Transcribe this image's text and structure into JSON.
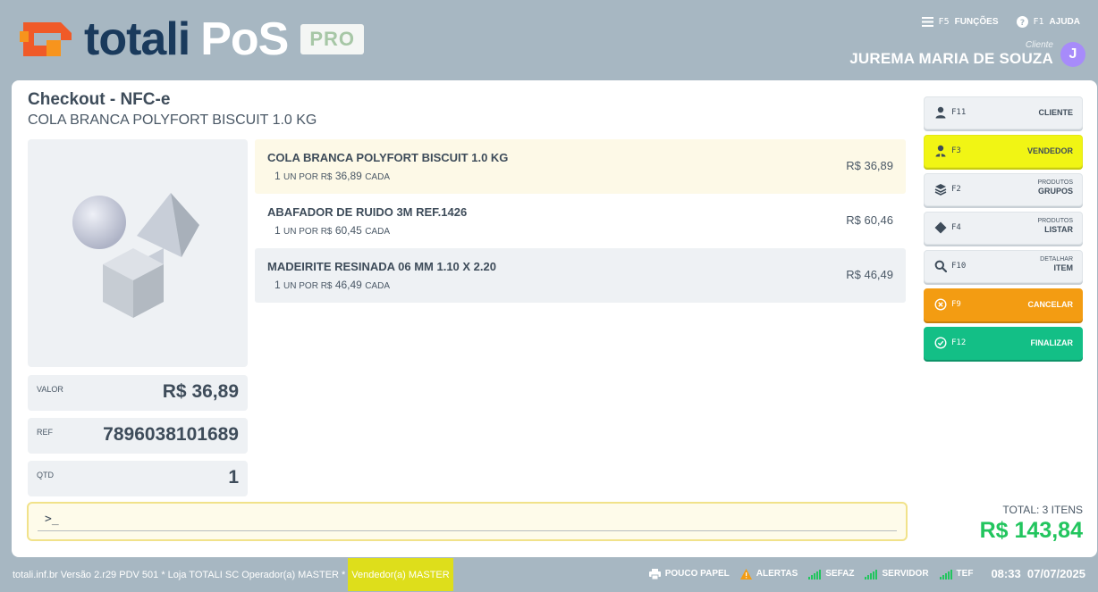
{
  "brand": {
    "name": "totali",
    "product": "PoS",
    "edition": "PRO"
  },
  "top_actions": [
    {
      "key": "F5",
      "label": "FUNÇÕES",
      "icon": "menu-icon"
    },
    {
      "key": "F1",
      "label": "AJUDA",
      "icon": "help-icon"
    }
  ],
  "client": {
    "label": "Cliente",
    "name": "JUREMA MARIA DE SOUZA",
    "initial": "J"
  },
  "checkout": {
    "title": "Checkout - NFC-e",
    "current_product": "COLA BRANCA POLYFORT BISCUIT 1.0 KG"
  },
  "info": {
    "valor_label": "VALOR",
    "valor": "R$ 36,89",
    "ref_label": "REF",
    "ref": "7896038101689",
    "qtd_label": "QTD",
    "qtd": "1"
  },
  "items": [
    {
      "name": "COLA BRANCA POLYFORT BISCUIT 1.0 KG",
      "qty": "1",
      "unit_text": "UN POR R$",
      "unit_price": "36,89",
      "each_text": "CADA",
      "price": "R$ 36,89"
    },
    {
      "name": "ABAFADOR DE RUIDO 3M REF.1426",
      "qty": "1",
      "unit_text": "UN POR R$",
      "unit_price": "60,45",
      "each_text": "CADA",
      "price": "R$ 60,46"
    },
    {
      "name": "MADEIRITE RESINADA 06 MM 1.10 X 2.20",
      "qty": "1",
      "unit_text": "UN POR R$",
      "unit_price": "46,49",
      "each_text": "CADA",
      "price": "R$ 46,49"
    }
  ],
  "command": {
    "prompt": ">_",
    "value": ""
  },
  "side_buttons": {
    "cliente": {
      "key": "F11",
      "label": "CLIENTE"
    },
    "vendedor": {
      "key": "F3",
      "label": "VENDEDOR"
    },
    "grupos": {
      "key": "F2",
      "line1": "PRODUTOS",
      "line2": "GRUPOS"
    },
    "listar": {
      "key": "F4",
      "line1": "PRODUTOS",
      "line2": "LISTAR"
    },
    "detalhar": {
      "key": "F10",
      "line1": "DETALHAR",
      "line2": "ITEM"
    },
    "cancelar": {
      "key": "F9",
      "label": "CANCELAR"
    },
    "finalizar": {
      "key": "F12",
      "label": "FINALIZAR"
    }
  },
  "total": {
    "label": "TOTAL: 3 ITENS",
    "value": "R$ 143,84"
  },
  "footer": {
    "info": "totali.inf.br Versão 2.r29 PDV 501  *  Loja TOTALI SC Operador(a) MASTER   *",
    "vendor": "Vendedor(a) MASTER",
    "status": {
      "paper": "POUCO PAPEL",
      "alerts": "ALERTAS",
      "sefaz": "SEFAZ",
      "server": "SERVIDOR",
      "tef": "TEF"
    },
    "time": "08:33",
    "date": "07/07/2025"
  },
  "colors": {
    "accent_orange": "#f39c12",
    "accent_green": "#13bf86",
    "accent_yellow": "#f1f514",
    "total_green": "#22c55e",
    "avatar": "#a78bfa",
    "background": "#a7b7c2"
  }
}
